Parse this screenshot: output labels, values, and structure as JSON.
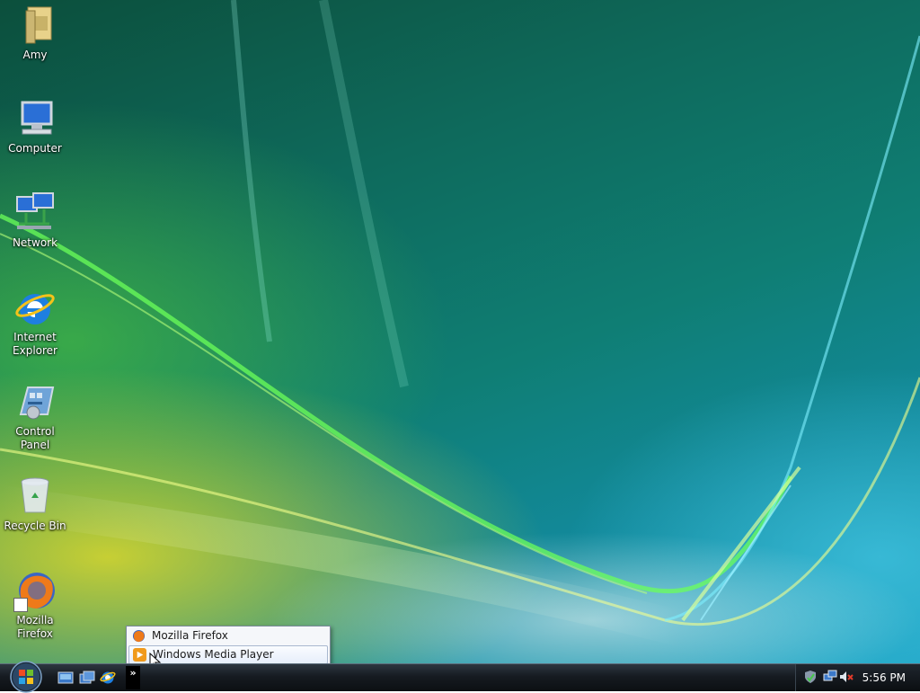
{
  "desktop": {
    "icons": [
      {
        "label": "Amy",
        "icon": "user-folder-icon"
      },
      {
        "label": "Computer",
        "icon": "computer-icon"
      },
      {
        "label": "Network",
        "icon": "network-icon"
      },
      {
        "label": "Internet Explorer",
        "icon": "internet-explorer-icon"
      },
      {
        "label": "Control Panel",
        "icon": "control-panel-icon"
      },
      {
        "label": "Recycle Bin",
        "icon": "recycle-bin-icon"
      },
      {
        "label": "Mozilla Firefox",
        "icon": "firefox-icon"
      }
    ]
  },
  "overflow_menu": {
    "items": [
      {
        "label": "Mozilla Firefox",
        "icon": "firefox-icon"
      },
      {
        "label": "Windows Media Player",
        "icon": "media-player-icon",
        "highlighted": true
      }
    ]
  },
  "taskbar": {
    "start_icon": "windows-orb-icon",
    "quick_launch": [
      {
        "icon": "show-desktop-icon"
      },
      {
        "icon": "switch-windows-icon"
      },
      {
        "icon": "internet-explorer-icon"
      }
    ],
    "chevron": "»",
    "tray": {
      "icons": [
        "security-shield-icon",
        "network-status-icon",
        "volume-muted-icon"
      ],
      "clock": "5:56 PM"
    }
  },
  "colors": {
    "taskbar": "#161b21",
    "menu_highlight_border": "#a9b8cf"
  }
}
